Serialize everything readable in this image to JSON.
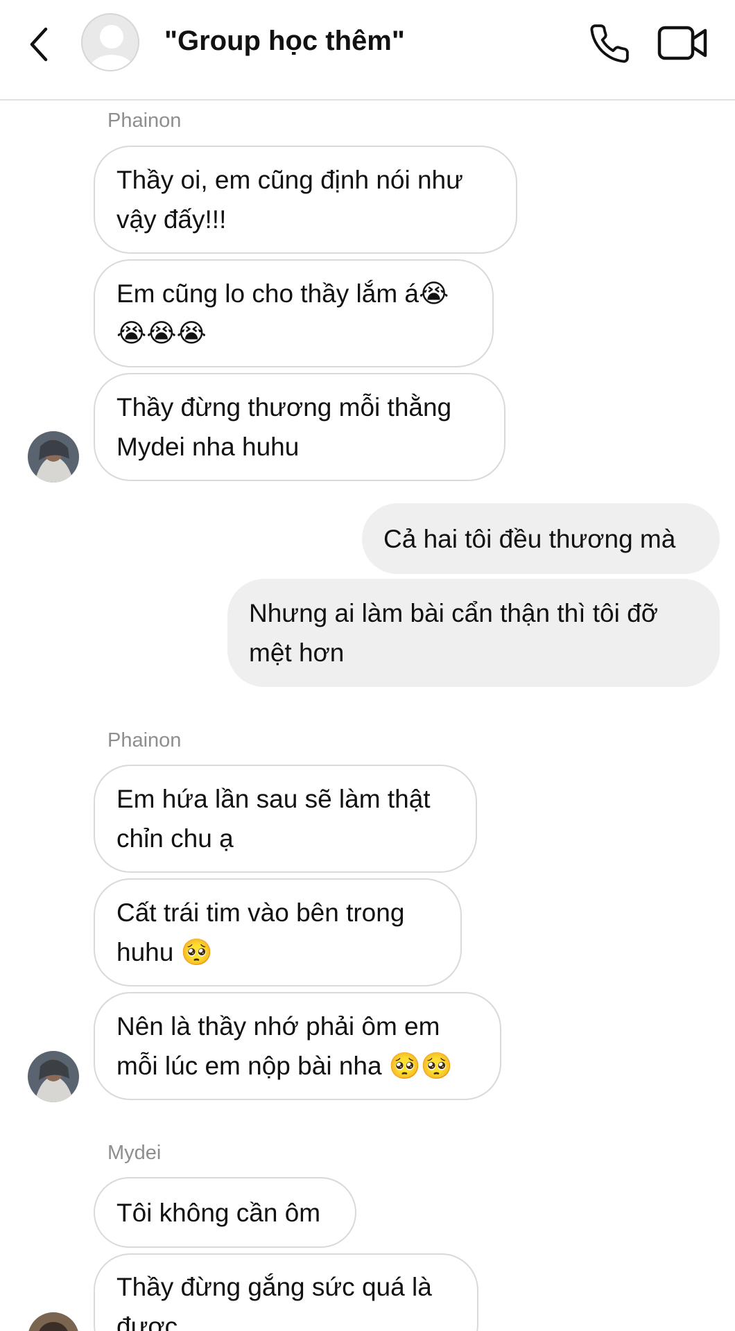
{
  "header": {
    "title": "\"Group học thêm\""
  },
  "messages": [
    {
      "sender": "Phainon"
    },
    {
      "text": "Thầy oi, em cũng định nói như\nvậy đấy!!!"
    },
    {
      "text": "Em cũng lo cho thầy lắm á😭\n😭😭😭"
    },
    {
      "text": "Thầy đừng thương mỗi thằng\nMydei nha huhu"
    },
    {
      "text": "Cả hai tôi đều thương mà"
    },
    {
      "text": "Nhưng ai làm bài cẩn thận thì tôi đỡ\nmệt hơn"
    },
    {
      "sender": "Phainon"
    },
    {
      "text": "Em hứa lần sau sẽ làm thật\nchỉn chu ạ"
    },
    {
      "text": "Cất trái tim vào bên trong\nhuhu 🥺"
    },
    {
      "text": "Nên là thầy nhớ phải ôm em\nmỗi lúc em nộp bài nha 🥺🥺"
    },
    {
      "sender": "Mydei"
    },
    {
      "text": "Tôi không cần ôm"
    },
    {
      "text": "Thầy đừng gắng sức quá là\nđược"
    }
  ],
  "colors": {
    "incoming_bubble_border": "#d9d9d9",
    "outgoing_bubble_bg": "#efefef",
    "sender_label": "#8e8e8e"
  }
}
